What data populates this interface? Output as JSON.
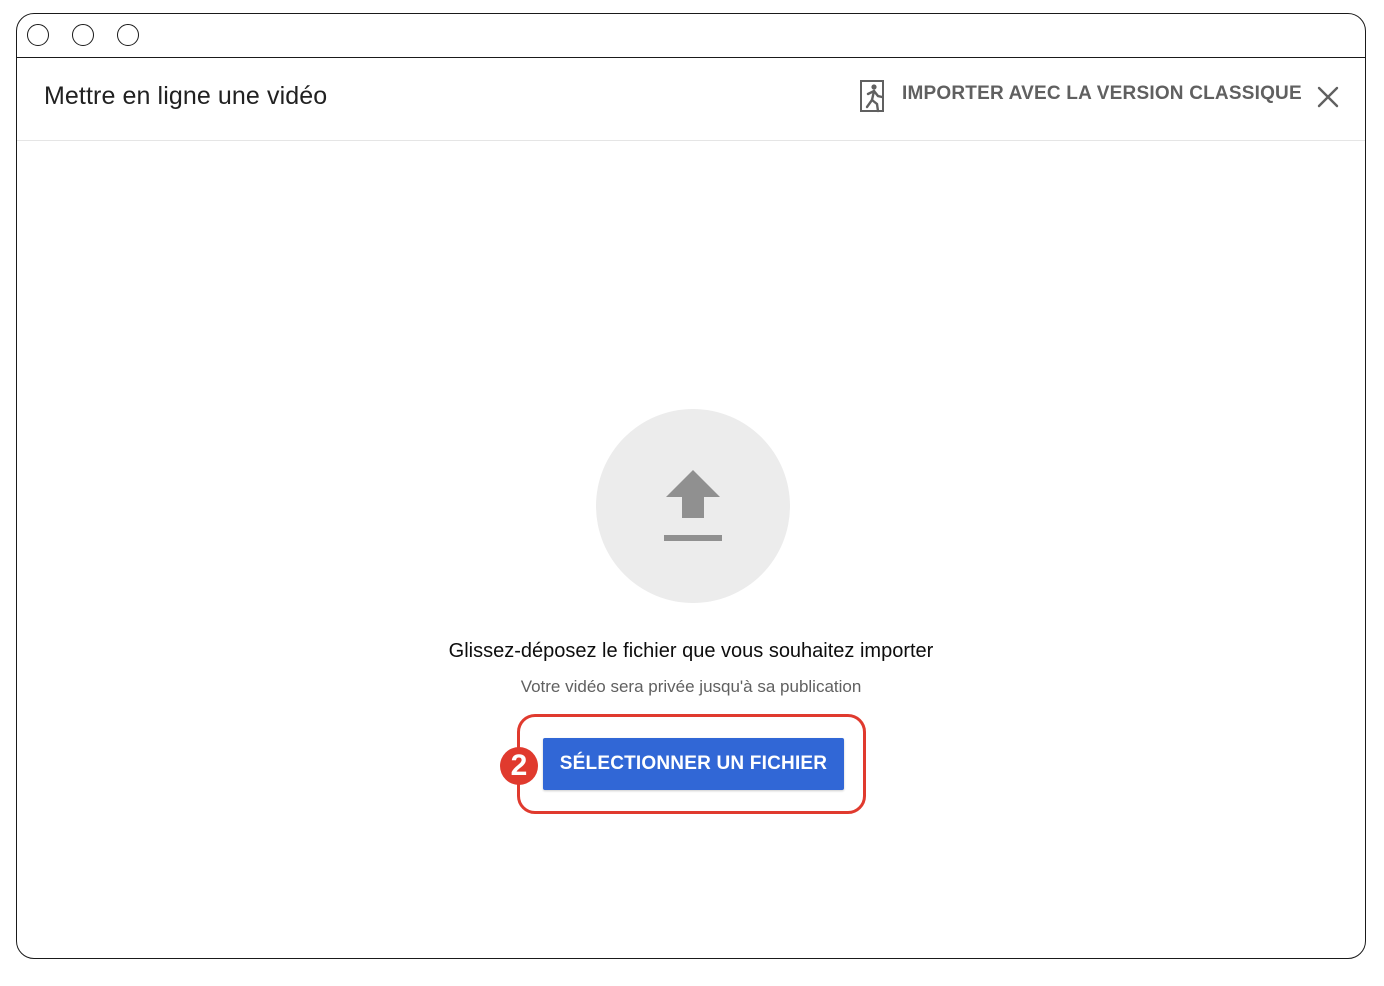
{
  "dialog": {
    "title": "Mettre en ligne une vidéo",
    "classic_link": "IMPORTER AVEC LA VERSION CLASSIQUE",
    "close_icon": "close-icon"
  },
  "upload": {
    "icon": "upload-arrow-icon",
    "drop_text": "Glissez-déposez le fichier que vous souhaitez importer",
    "privacy_note": "Votre vidéo sera privée jusqu'à sa publication",
    "select_button": "SÉLECTIONNER UN FICHIER"
  },
  "annotation": {
    "step_number": "2",
    "color": "#e03a2e"
  },
  "colors": {
    "primary_button": "#3167d6",
    "circle_bg": "#ececec"
  }
}
